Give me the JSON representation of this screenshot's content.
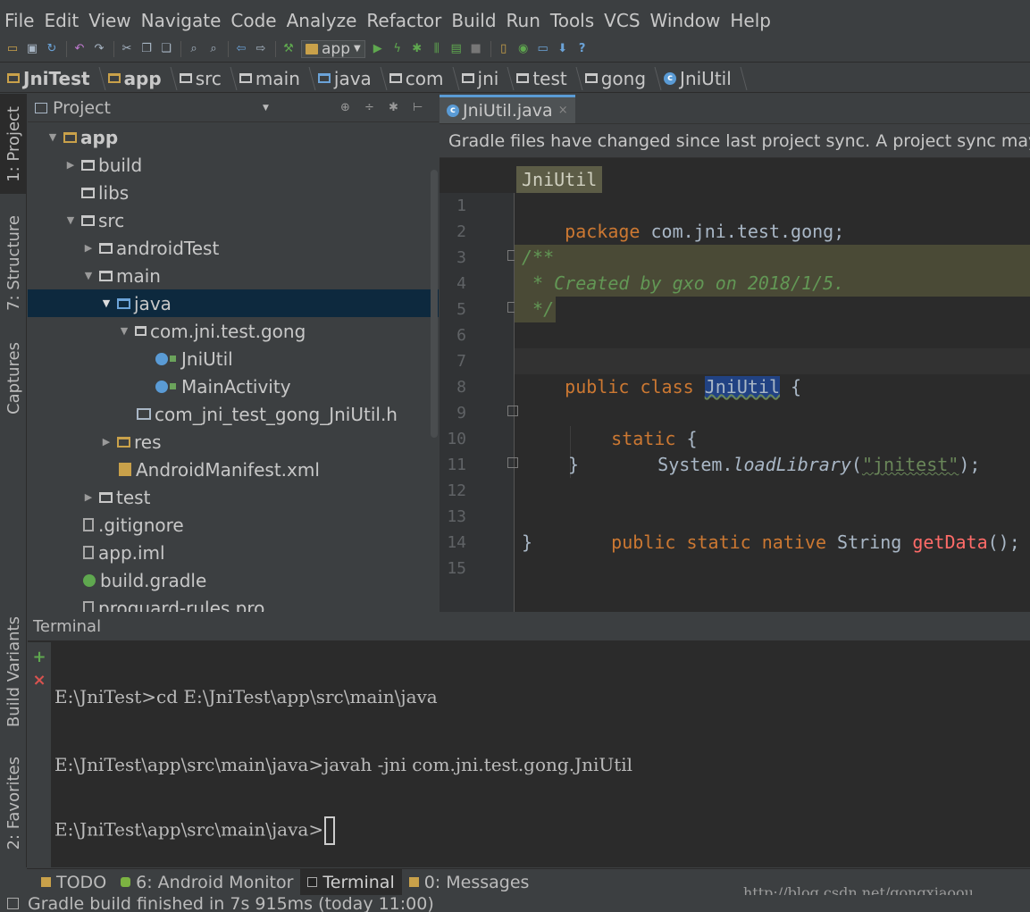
{
  "menu": [
    "File",
    "Edit",
    "View",
    "Navigate",
    "Code",
    "Analyze",
    "Refactor",
    "Build",
    "Run",
    "Tools",
    "VCS",
    "Window",
    "Help"
  ],
  "toolbar": {
    "run_config": "app",
    "icons": [
      "open-icon",
      "save-icon",
      "sync-icon",
      "undo-icon",
      "redo-icon",
      "cut-icon",
      "copy-icon",
      "paste-icon",
      "find-icon",
      "replace-icon",
      "back-icon",
      "forward-icon",
      "make-icon",
      "run-icon",
      "apply-changes-icon",
      "debug-icon",
      "profile-icon",
      "attach-icon",
      "stop-icon",
      "avd-manager-icon",
      "sdk-manager-icon",
      "device-icon",
      "android-icon",
      "help-icon"
    ]
  },
  "breadcrumbs": [
    "JniTest",
    "app",
    "src",
    "main",
    "java",
    "com",
    "jni",
    "test",
    "gong",
    "JniUtil"
  ],
  "left_tabs": {
    "project": "1: Project",
    "structure": "7: Structure",
    "captures": "Captures",
    "build_variants": "Build Variants",
    "favorites": "2: Favorites"
  },
  "project_panel": {
    "title": "Project",
    "tree": [
      {
        "label": "app",
        "arrow": "▼",
        "kind": "module",
        "bold": true
      },
      {
        "label": "build",
        "arrow": "▶",
        "kind": "folder"
      },
      {
        "label": "libs",
        "arrow": "",
        "kind": "folder"
      },
      {
        "label": "src",
        "arrow": "▼",
        "kind": "folder"
      },
      {
        "label": "androidTest",
        "arrow": "▶",
        "kind": "folder"
      },
      {
        "label": "main",
        "arrow": "▼",
        "kind": "folder"
      },
      {
        "label": "java",
        "arrow": "▼",
        "kind": "folder",
        "selected": true
      },
      {
        "label": "com.jni.test.gong",
        "arrow": "▼",
        "kind": "package"
      },
      {
        "label": "JniUtil",
        "arrow": "",
        "kind": "class"
      },
      {
        "label": "MainActivity",
        "arrow": "",
        "kind": "class"
      },
      {
        "label": "com_jni_test_gong_JniUtil.h",
        "arrow": "",
        "kind": "header"
      },
      {
        "label": "res",
        "arrow": "▶",
        "kind": "folder"
      },
      {
        "label": "AndroidManifest.xml",
        "arrow": "",
        "kind": "xml"
      },
      {
        "label": "test",
        "arrow": "▶",
        "kind": "folder"
      },
      {
        "label": ".gitignore",
        "arrow": "",
        "kind": "file"
      },
      {
        "label": "app.iml",
        "arrow": "",
        "kind": "file"
      },
      {
        "label": "build.gradle",
        "arrow": "",
        "kind": "gradle"
      },
      {
        "label": "proguard-rules.pro",
        "arrow": "",
        "kind": "file"
      }
    ]
  },
  "editor": {
    "tab": "JniUtil.java",
    "banner": "Gradle files have changed since last project sync. A project sync may",
    "breadcrumb": "JniUtil",
    "line_numbers": [
      "1",
      "2",
      "3",
      "4",
      "5",
      "6",
      "7",
      "8",
      "9",
      "10",
      "11",
      "12",
      "13",
      "14",
      "15"
    ],
    "code": {
      "l1_kw": "package",
      "l1_rest": " com.jni.test.gong;",
      "l3": "/**",
      "l4": " * Created by gxo on 2018/1/5.",
      "l5": " */",
      "l7_kw": "public class ",
      "l7_name": "JniUtil",
      "l7_rest": " {",
      "l9_kw": "static",
      "l9_rest": " {",
      "l10_pre": "System.",
      "l10_fn": "loadLibrary",
      "l10_open": "(",
      "l10_str": "\"jnitest\"",
      "l10_close": ");",
      "l11": "}",
      "l13_kw": "public static native ",
      "l13_type": "String ",
      "l13_fn": "getData",
      "l13_rest": "();",
      "l14": "}"
    }
  },
  "terminal": {
    "title": "Terminal",
    "lines": [
      "E:\\JniTest>cd E:\\JniTest\\app\\src\\main\\java",
      "E:\\JniTest\\app\\src\\main\\java>javah -jni com.jni.test.gong.JniUtil",
      "E:\\JniTest\\app\\src\\main\\java>"
    ]
  },
  "bottom_tabs": [
    {
      "label": "TODO",
      "active": false
    },
    {
      "label": "6: Android Monitor",
      "active": false
    },
    {
      "label": "Terminal",
      "active": true
    },
    {
      "label": "0: Messages",
      "active": false
    }
  ],
  "watermark": "http://blog.csdn.net/gongxiaoou",
  "status": "Gradle build finished in 7s 915ms (today 11:00)"
}
